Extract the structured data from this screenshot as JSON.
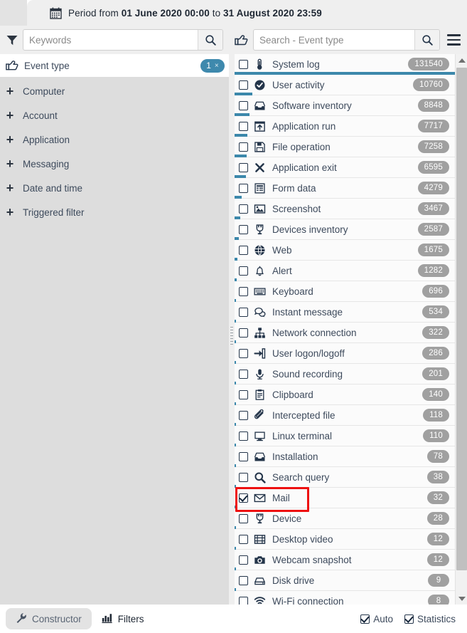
{
  "header": {
    "calendar_icon": "calendar-icon",
    "period_prefix": "Period from ",
    "period_from": "01 June 2020 00:00",
    "period_mid": " to ",
    "period_to": "31 August 2020 23:59"
  },
  "search": {
    "filter_icon": "funnel-icon",
    "keywords_placeholder": "Keywords",
    "keywords_value": "",
    "keywords_search_icon": "search-icon",
    "hand_icon": "pointing-hand-icon",
    "event_type_placeholder": "Search - Event type",
    "event_type_value": "",
    "event_type_search_icon": "search-icon",
    "menu_icon": "hamburger-menu-icon"
  },
  "sidebar": {
    "title": "Event type",
    "title_icon": "pointing-hand-icon",
    "badge_count": "1",
    "badge_clear": "×",
    "items": [
      {
        "label": "Computer",
        "expander": "+"
      },
      {
        "label": "Account",
        "expander": "+"
      },
      {
        "label": "Application",
        "expander": "+"
      },
      {
        "label": "Messaging",
        "expander": "+"
      },
      {
        "label": "Date and time",
        "expander": "+"
      },
      {
        "label": "Triggered filter",
        "expander": "+"
      }
    ]
  },
  "event_list": {
    "max_count": 131540,
    "items": [
      {
        "label": "System log",
        "count": "131540",
        "icon": "thermometer-icon",
        "checked": false,
        "highlighted": false
      },
      {
        "label": "User activity",
        "count": "10760",
        "icon": "check-circle-icon",
        "checked": false,
        "highlighted": false
      },
      {
        "label": "Software inventory",
        "count": "8848",
        "icon": "inbox-tray-icon",
        "checked": false,
        "highlighted": false
      },
      {
        "label": "Application run",
        "count": "7717",
        "icon": "app-run-icon",
        "checked": false,
        "highlighted": false
      },
      {
        "label": "File operation",
        "count": "7258",
        "icon": "floppy-save-icon",
        "checked": false,
        "highlighted": false
      },
      {
        "label": "Application exit",
        "count": "6595",
        "icon": "close-x-icon",
        "checked": false,
        "highlighted": false
      },
      {
        "label": "Form data",
        "count": "4279",
        "icon": "form-icon",
        "checked": false,
        "highlighted": false
      },
      {
        "label": "Screenshot",
        "count": "3467",
        "icon": "image-icon",
        "checked": false,
        "highlighted": false
      },
      {
        "label": "Devices inventory",
        "count": "2587",
        "icon": "plug-icon",
        "checked": false,
        "highlighted": false
      },
      {
        "label": "Web",
        "count": "1675",
        "icon": "globe-icon",
        "checked": false,
        "highlighted": false
      },
      {
        "label": "Alert",
        "count": "1282",
        "icon": "bell-icon",
        "checked": false,
        "highlighted": false
      },
      {
        "label": "Keyboard",
        "count": "696",
        "icon": "keyboard-icon",
        "checked": false,
        "highlighted": false
      },
      {
        "label": "Instant message",
        "count": "534",
        "icon": "chat-bubble-icon",
        "checked": false,
        "highlighted": false
      },
      {
        "label": "Network connection",
        "count": "322",
        "icon": "network-icon",
        "checked": false,
        "highlighted": false
      },
      {
        "label": "User logon/logoff",
        "count": "286",
        "icon": "login-arrow-icon",
        "checked": false,
        "highlighted": false
      },
      {
        "label": "Sound recording",
        "count": "201",
        "icon": "microphone-icon",
        "checked": false,
        "highlighted": false
      },
      {
        "label": "Clipboard",
        "count": "140",
        "icon": "clipboard-icon",
        "checked": false,
        "highlighted": false
      },
      {
        "label": "Intercepted file",
        "count": "118",
        "icon": "paperclip-icon",
        "checked": false,
        "highlighted": false
      },
      {
        "label": "Linux terminal",
        "count": "110",
        "icon": "monitor-icon",
        "checked": false,
        "highlighted": false
      },
      {
        "label": "Installation",
        "count": "78",
        "icon": "inbox-tray-icon",
        "checked": false,
        "highlighted": false
      },
      {
        "label": "Search query",
        "count": "38",
        "icon": "search-icon",
        "checked": false,
        "highlighted": false
      },
      {
        "label": "Mail",
        "count": "32",
        "icon": "envelope-icon",
        "checked": true,
        "highlighted": true
      },
      {
        "label": "Device",
        "count": "28",
        "icon": "plug-icon",
        "checked": false,
        "highlighted": false
      },
      {
        "label": "Desktop video",
        "count": "12",
        "icon": "film-icon",
        "checked": false,
        "highlighted": false
      },
      {
        "label": "Webcam snapshot",
        "count": "12",
        "icon": "camera-icon",
        "checked": false,
        "highlighted": false
      },
      {
        "label": "Disk drive",
        "count": "9",
        "icon": "disk-drive-icon",
        "checked": false,
        "highlighted": false
      },
      {
        "label": "Wi-Fi connection",
        "count": "8",
        "icon": "wifi-icon",
        "checked": false,
        "highlighted": false
      }
    ]
  },
  "bottombar": {
    "constructor_label": "Constructor",
    "constructor_icon": "wrench-icon",
    "filters_label": "Filters",
    "filters_icon": "bar-chart-icon",
    "auto_label": "Auto",
    "auto_checked": true,
    "statistics_label": "Statistics",
    "statistics_checked": true
  },
  "colors": {
    "accent_blue": "#3c88ab",
    "badge_gray": "#a0a0a0",
    "highlight_red": "#ee1111",
    "panel_gray": "#dddddd",
    "chrome_gray": "#efefef"
  }
}
